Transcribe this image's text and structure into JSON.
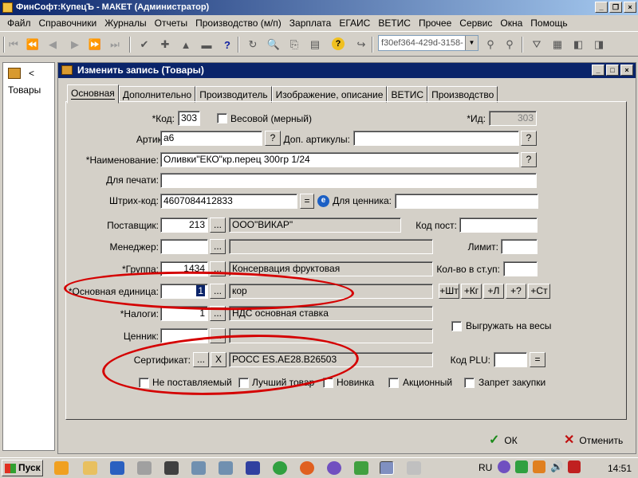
{
  "app": {
    "title": "ФинСофт:КупецЪ - МАКЕТ  (Администратор)",
    "menu": [
      "Файл",
      "Справочники",
      "Журналы",
      "Отчеты",
      "Производство (м/п)",
      "Зарплата",
      "ЕГАИС",
      "ВЕТИС",
      "Прочее",
      "Сервис",
      "Окна",
      "Помощь"
    ],
    "toolbar_combo": "f30ef364-429d-3158-"
  },
  "leftpane": {
    "label": "Товары",
    "chevron": "<"
  },
  "dialog": {
    "title": "Изменить запись (Товары)",
    "tabs": [
      "Основная",
      "Дополнительно",
      "Производитель",
      "Изображение, описание",
      "ВЕТИС",
      "Производство"
    ],
    "fields": {
      "kod_label": "*Код:",
      "kod_value": "303",
      "vesovoy_label": "Весовой (мерный)",
      "id_label": "*Ид:",
      "id_value": "303",
      "artikul_label": "Артикул:",
      "artikul_value": "а6",
      "dop_artikuly_label": "Доп. артикулы:",
      "naim_label": "*Наименование:",
      "naim_value": "Оливки\"ЕКО\"кр.перец 300гр 1/24",
      "dlya_pechati_label": "Для печати:",
      "shtrih_label": "Штрих-код:",
      "shtrih_value": "4607084412833",
      "dlya_cennika_label": "Для ценника:",
      "postavshik_label": "Поставщик:",
      "postavshik_code": "213",
      "postavshik_name": "ООО\"ВИКАР\"",
      "kod_post_label": "Код пост:",
      "menedzher_label": "Менеджер:",
      "limit_label": "Лимит:",
      "gruppa_label": "*Группа:",
      "gruppa_code": "1434",
      "gruppa_name": "Консервация фруктовая",
      "kol_vo_label": "Кол-во в ст.уп:",
      "osn_ed_label": "*Основная единица:",
      "osn_ed_code": "1",
      "osn_ed_name": "кор",
      "unit_buttons": [
        "+Шт",
        "+Кг",
        "+Л",
        "+?",
        "+Ст"
      ],
      "nalogi_label": "*Налоги:",
      "nalogi_code": "1",
      "nalogi_name": "НДС основная ставка",
      "cennik_label": "Ценник:",
      "vygruzhat_label": "Выгружать на весы",
      "sertifikat_label": "Сертификат:",
      "sertifikat_value": "РОСС ES.AE28.B26503",
      "kod_plu_label": "Код PLU:",
      "checkbox_row": [
        "Не поставляемый",
        "Лучший товар",
        "Новинка",
        "Акционный",
        "Запрет закупки"
      ]
    },
    "ok_label": "ОК",
    "cancel_label": "Отменить"
  },
  "taskbar": {
    "start_label": "Пуск",
    "lang": "RU",
    "clock": "14:51"
  }
}
